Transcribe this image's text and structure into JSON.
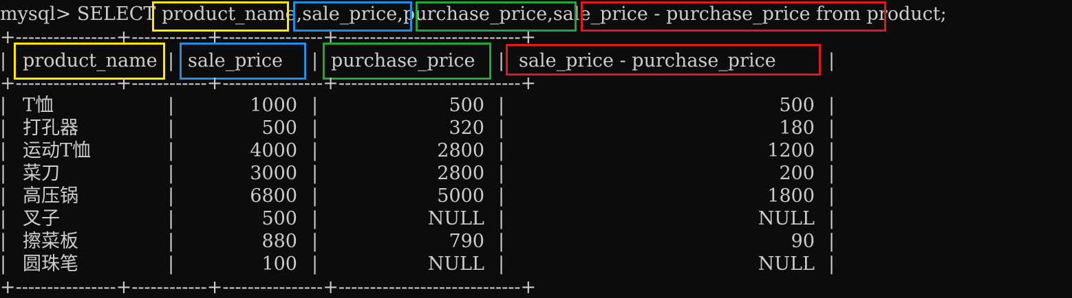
{
  "prompt": {
    "prefix": "mysql> ",
    "keyword": "SELECT ",
    "col1": "product_name",
    "comma1": ",",
    "col2": "sale_price",
    "comma2": ",",
    "col3": "purchase_price",
    "comma3": ",",
    "col4": "sale_price - purchase_price",
    "suffix": " from product;"
  },
  "highlight_colors": {
    "product_name": "#ffea00",
    "sale_price": "#1e90e8",
    "purchase_price": "#1fa836",
    "difference": "#e8151b"
  },
  "separator": "+----------------+------------+----------------+-----------------------------+",
  "headers": [
    "product_name",
    "sale_price",
    "purchase_price",
    "sale_price - purchase_price"
  ],
  "rows": [
    [
      "T恤",
      "1000",
      "500",
      "500"
    ],
    [
      "打孔器",
      "500",
      "320",
      "180"
    ],
    [
      "运动T恤",
      "4000",
      "2800",
      "1200"
    ],
    [
      "菜刀",
      "3000",
      "2800",
      "200"
    ],
    [
      "高压锅",
      "6800",
      "5000",
      "1800"
    ],
    [
      "叉子",
      "500",
      "NULL",
      "NULL"
    ],
    [
      "擦菜板",
      "880",
      "790",
      "90"
    ],
    [
      "圆珠笔",
      "100",
      "NULL",
      "NULL"
    ]
  ]
}
